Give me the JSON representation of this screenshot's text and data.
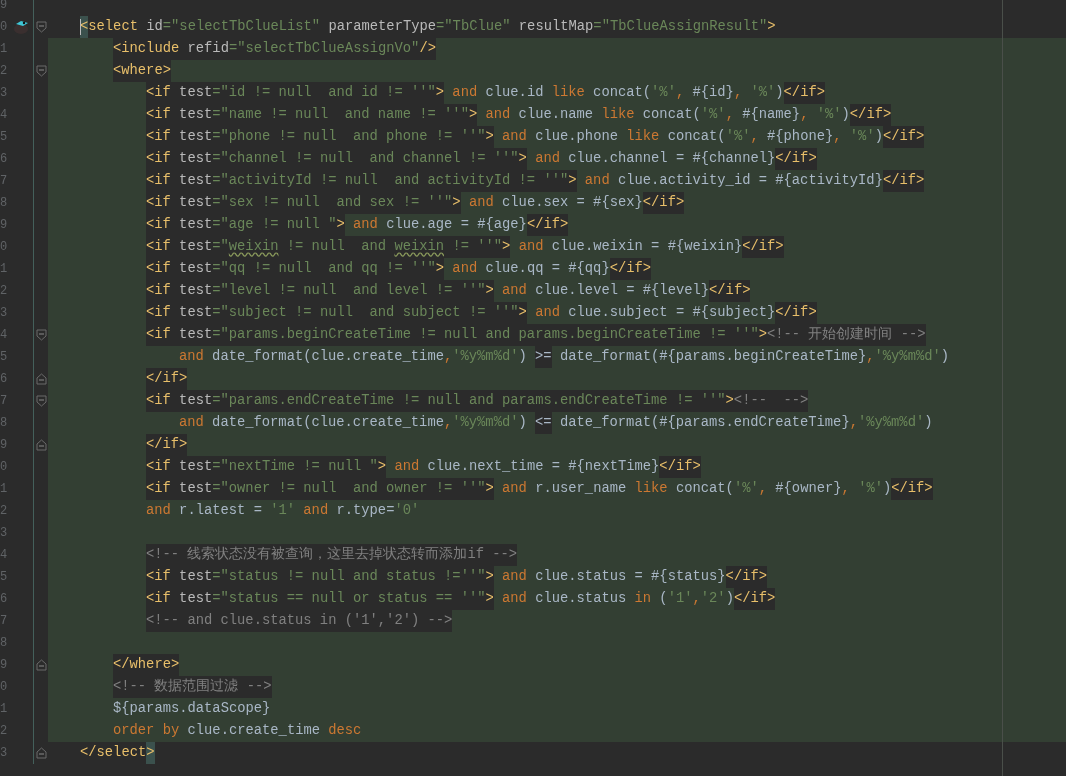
{
  "lines": [
    {
      "number": "9"
    },
    {
      "number": "0",
      "gutter_icon": true,
      "caret": true,
      "fold_start": true,
      "tokens": [
        {
          "kind": "tag",
          "text": "<",
          "matched": true
        },
        {
          "kind": "tag",
          "text": "select"
        },
        {
          "kind": "attr",
          "text": " id"
        },
        {
          "kind": "value",
          "text": "=\"selectTbClueList\""
        },
        {
          "kind": "attr",
          "text": " parameterType"
        },
        {
          "kind": "value",
          "text": "=\"TbClue\""
        },
        {
          "kind": "attr",
          "text": " resultMap"
        },
        {
          "kind": "value",
          "text": "=\"TbClueAssignResult\""
        },
        {
          "kind": "tag",
          "text": ">"
        }
      ],
      "children": [
        {
          "number": "1",
          "tokens": [
            {
              "kind": "tag",
              "text": "<include"
            },
            {
              "kind": "attr",
              "text": " refid"
            },
            {
              "kind": "value",
              "text": "=\"selectTbClueAssignVo\""
            },
            {
              "kind": "tag",
              "text": "/>"
            }
          ]
        },
        {
          "number": "2",
          "fold_start": true,
          "tokens": [
            {
              "kind": "tag",
              "text": "<where>"
            }
          ],
          "children": [
            {
              "number": "3",
              "tokens": [
                {
                  "kind": "tag",
                  "text": "<if"
                },
                {
                  "kind": "attr",
                  "text": " test"
                },
                {
                  "kind": "value",
                  "text": "=\"id != null  and id != ''\""
                },
                {
                  "kind": "tag",
                  "text": ">"
                },
                {
                  "kind": "kw",
                  "text": " and"
                },
                {
                  "kind": "plain",
                  "text": " clue.id "
                },
                {
                  "kind": "kw",
                  "text": "like"
                },
                {
                  "kind": "plain",
                  "text": " concat("
                },
                {
                  "kind": "str",
                  "text": "'%'"
                },
                {
                  "kind": "kw",
                  "text": ", "
                },
                {
                  "kind": "plain",
                  "text": "#{id}"
                },
                {
                  "kind": "kw",
                  "text": ", "
                },
                {
                  "kind": "str",
                  "text": "'%'"
                },
                {
                  "kind": "plain",
                  "text": ")"
                },
                {
                  "kind": "tag",
                  "text": "</if>"
                }
              ]
            },
            {
              "number": "4",
              "tokens": [
                {
                  "kind": "tag",
                  "text": "<if"
                },
                {
                  "kind": "attr",
                  "text": " test"
                },
                {
                  "kind": "value",
                  "text": "=\"name != null  and name != ''\""
                },
                {
                  "kind": "tag",
                  "text": ">"
                },
                {
                  "kind": "kw",
                  "text": " and"
                },
                {
                  "kind": "plain",
                  "text": " clue.name "
                },
                {
                  "kind": "kw",
                  "text": "like"
                },
                {
                  "kind": "plain",
                  "text": " concat("
                },
                {
                  "kind": "str",
                  "text": "'%'"
                },
                {
                  "kind": "kw",
                  "text": ", "
                },
                {
                  "kind": "plain",
                  "text": "#{name}"
                },
                {
                  "kind": "kw",
                  "text": ", "
                },
                {
                  "kind": "str",
                  "text": "'%'"
                },
                {
                  "kind": "plain",
                  "text": ")"
                },
                {
                  "kind": "tag",
                  "text": "</if>"
                }
              ]
            },
            {
              "number": "5",
              "tokens": [
                {
                  "kind": "tag",
                  "text": "<if"
                },
                {
                  "kind": "attr",
                  "text": " test"
                },
                {
                  "kind": "value",
                  "text": "=\"phone != null  and phone != ''\""
                },
                {
                  "kind": "tag",
                  "text": ">"
                },
                {
                  "kind": "kw",
                  "text": " and"
                },
                {
                  "kind": "plain",
                  "text": " clue.phone "
                },
                {
                  "kind": "kw",
                  "text": "like"
                },
                {
                  "kind": "plain",
                  "text": " concat("
                },
                {
                  "kind": "str",
                  "text": "'%'"
                },
                {
                  "kind": "kw",
                  "text": ", "
                },
                {
                  "kind": "plain",
                  "text": "#{phone}"
                },
                {
                  "kind": "kw",
                  "text": ", "
                },
                {
                  "kind": "str",
                  "text": "'%'"
                },
                {
                  "kind": "plain",
                  "text": ")"
                },
                {
                  "kind": "tag",
                  "text": "</if>"
                }
              ]
            },
            {
              "number": "6",
              "tokens": [
                {
                  "kind": "tag",
                  "text": "<if"
                },
                {
                  "kind": "attr",
                  "text": " test"
                },
                {
                  "kind": "value",
                  "text": "=\"channel != null  and channel != ''\""
                },
                {
                  "kind": "tag",
                  "text": ">"
                },
                {
                  "kind": "kw",
                  "text": " and"
                },
                {
                  "kind": "plain",
                  "text": " clue.channel = #{channel}"
                },
                {
                  "kind": "tag",
                  "text": "</if>"
                }
              ]
            },
            {
              "number": "7",
              "tokens": [
                {
                  "kind": "tag",
                  "text": "<if"
                },
                {
                  "kind": "attr",
                  "text": " test"
                },
                {
                  "kind": "value",
                  "text": "=\"activityId != null  and activityId != ''\""
                },
                {
                  "kind": "tag",
                  "text": ">"
                },
                {
                  "kind": "kw",
                  "text": " and"
                },
                {
                  "kind": "plain",
                  "text": " clue.activity_id = #{activityId}"
                },
                {
                  "kind": "tag",
                  "text": "</if>"
                }
              ]
            },
            {
              "number": "8",
              "tokens": [
                {
                  "kind": "tag",
                  "text": "<if"
                },
                {
                  "kind": "attr",
                  "text": " test"
                },
                {
                  "kind": "value",
                  "text": "=\"sex != null  and sex != ''\""
                },
                {
                  "kind": "tag",
                  "text": ">"
                },
                {
                  "kind": "kw",
                  "text": " and"
                },
                {
                  "kind": "plain",
                  "text": " clue.sex = #{sex}"
                },
                {
                  "kind": "tag",
                  "text": "</if>"
                }
              ]
            },
            {
              "number": "9",
              "tokens": [
                {
                  "kind": "tag",
                  "text": "<if"
                },
                {
                  "kind": "attr",
                  "text": " test"
                },
                {
                  "kind": "value",
                  "text": "=\"age != null \""
                },
                {
                  "kind": "tag",
                  "text": ">"
                },
                {
                  "kind": "kw",
                  "text": " and"
                },
                {
                  "kind": "plain",
                  "text": " clue.age = #{age}"
                },
                {
                  "kind": "tag",
                  "text": "</if>"
                }
              ]
            },
            {
              "number": "0",
              "tokens": [
                {
                  "kind": "tag",
                  "text": "<if"
                },
                {
                  "kind": "attr",
                  "text": " test"
                },
                {
                  "kind": "value",
                  "text": "=\""
                },
                {
                  "kind": "value",
                  "text": "weixin",
                  "misspelled": true
                },
                {
                  "kind": "value",
                  "text": " != null  and "
                },
                {
                  "kind": "value",
                  "text": "weixin",
                  "misspelled": true
                },
                {
                  "kind": "value",
                  "text": " != ''\""
                },
                {
                  "kind": "tag",
                  "text": ">"
                },
                {
                  "kind": "kw",
                  "text": " and"
                },
                {
                  "kind": "plain",
                  "text": " clue.weixin = #{weixin}"
                },
                {
                  "kind": "tag",
                  "text": "</if>"
                }
              ]
            },
            {
              "number": "1",
              "tokens": [
                {
                  "kind": "tag",
                  "text": "<if"
                },
                {
                  "kind": "attr",
                  "text": " test"
                },
                {
                  "kind": "value",
                  "text": "=\"qq != null  and qq != ''\""
                },
                {
                  "kind": "tag",
                  "text": ">"
                },
                {
                  "kind": "kw",
                  "text": " and"
                },
                {
                  "kind": "plain",
                  "text": " clue.qq = #{qq}"
                },
                {
                  "kind": "tag",
                  "text": "</if>"
                }
              ]
            },
            {
              "number": "2",
              "tokens": [
                {
                  "kind": "tag",
                  "text": "<if"
                },
                {
                  "kind": "attr",
                  "text": " test"
                },
                {
                  "kind": "value",
                  "text": "=\"level != null  and level != ''\""
                },
                {
                  "kind": "tag",
                  "text": ">"
                },
                {
                  "kind": "kw",
                  "text": " and"
                },
                {
                  "kind": "plain",
                  "text": " clue.level = #{level}"
                },
                {
                  "kind": "tag",
                  "text": "</if>"
                }
              ]
            },
            {
              "number": "3",
              "tokens": [
                {
                  "kind": "tag",
                  "text": "<if"
                },
                {
                  "kind": "attr",
                  "text": " test"
                },
                {
                  "kind": "value",
                  "text": "=\"subject != null  and subject != ''\""
                },
                {
                  "kind": "tag",
                  "text": ">"
                },
                {
                  "kind": "kw",
                  "text": " and"
                },
                {
                  "kind": "plain",
                  "text": " clue.subject = #{subject}"
                },
                {
                  "kind": "tag",
                  "text": "</if>"
                }
              ]
            },
            {
              "number": "4",
              "fold_start": true,
              "tokens": [
                {
                  "kind": "tag",
                  "text": "<if"
                },
                {
                  "kind": "attr",
                  "text": " test"
                },
                {
                  "kind": "value",
                  "text": "=\"params.beginCreateTime != null and params.beginCreateTime != ''\""
                },
                {
                  "kind": "tag",
                  "text": ">"
                },
                {
                  "kind": "comment",
                  "text": "<!-- 开始创建时间 -->"
                }
              ],
              "children": [
                {
                  "number": "5",
                  "tokens": [
                    {
                      "kind": "kw",
                      "text": "and"
                    },
                    {
                      "kind": "plain",
                      "text": " date_format(clue.create_time"
                    },
                    {
                      "kind": "kw",
                      "text": ","
                    },
                    {
                      "kind": "str",
                      "text": "'%y%m%d'"
                    },
                    {
                      "kind": "plain",
                      "text": ") "
                    },
                    {
                      "kind": "entity",
                      "text": ">="
                    },
                    {
                      "kind": "plain",
                      "text": " date_format(#{params.beginCreateTime}"
                    },
                    {
                      "kind": "kw",
                      "text": ","
                    },
                    {
                      "kind": "str",
                      "text": "'%y%m%d'"
                    },
                    {
                      "kind": "plain",
                      "text": ")"
                    }
                  ]
                }
              ]
            },
            {
              "number": "6",
              "fold_end": true,
              "tokens": [
                {
                  "kind": "tag",
                  "text": "</if>"
                }
              ]
            },
            {
              "number": "7",
              "fold_start": true,
              "tokens": [
                {
                  "kind": "tag",
                  "text": "<if"
                },
                {
                  "kind": "attr",
                  "text": " test"
                },
                {
                  "kind": "value",
                  "text": "=\"params.endCreateTime != null and params.endCreateTime != ''\""
                },
                {
                  "kind": "tag",
                  "text": ">"
                },
                {
                  "kind": "comment",
                  "text": "<!--  -->"
                }
              ],
              "children": [
                {
                  "number": "8",
                  "tokens": [
                    {
                      "kind": "kw",
                      "text": "and"
                    },
                    {
                      "kind": "plain",
                      "text": " date_format(clue.create_time"
                    },
                    {
                      "kind": "kw",
                      "text": ","
                    },
                    {
                      "kind": "str",
                      "text": "'%y%m%d'"
                    },
                    {
                      "kind": "plain",
                      "text": ") "
                    },
                    {
                      "kind": "entity",
                      "text": "<="
                    },
                    {
                      "kind": "plain",
                      "text": " date_format(#{params.endCreateTime}"
                    },
                    {
                      "kind": "kw",
                      "text": ","
                    },
                    {
                      "kind": "str",
                      "text": "'%y%m%d'"
                    },
                    {
                      "kind": "plain",
                      "text": ")"
                    }
                  ]
                }
              ]
            },
            {
              "number": "9",
              "fold_end": true,
              "tokens": [
                {
                  "kind": "tag",
                  "text": "</if>"
                }
              ]
            },
            {
              "number": "0",
              "tokens": [
                {
                  "kind": "tag",
                  "text": "<if"
                },
                {
                  "kind": "attr",
                  "text": " test"
                },
                {
                  "kind": "value",
                  "text": "=\"nextTime != null \""
                },
                {
                  "kind": "tag",
                  "text": ">"
                },
                {
                  "kind": "kw",
                  "text": " and"
                },
                {
                  "kind": "plain",
                  "text": " clue.next_time = #{nextTime}"
                },
                {
                  "kind": "tag",
                  "text": "</if>"
                }
              ]
            },
            {
              "number": "1",
              "tokens": [
                {
                  "kind": "tag",
                  "text": "<if"
                },
                {
                  "kind": "attr",
                  "text": " test"
                },
                {
                  "kind": "value",
                  "text": "=\"owner != null  and owner != ''\""
                },
                {
                  "kind": "tag",
                  "text": ">"
                },
                {
                  "kind": "kw",
                  "text": " and"
                },
                {
                  "kind": "plain",
                  "text": " r.user_name "
                },
                {
                  "kind": "kw",
                  "text": "like"
                },
                {
                  "kind": "plain",
                  "text": " concat("
                },
                {
                  "kind": "str",
                  "text": "'%'"
                },
                {
                  "kind": "kw",
                  "text": ", "
                },
                {
                  "kind": "plain",
                  "text": "#{owner}"
                },
                {
                  "kind": "kw",
                  "text": ", "
                },
                {
                  "kind": "str",
                  "text": "'%'"
                },
                {
                  "kind": "plain",
                  "text": ")"
                },
                {
                  "kind": "tag",
                  "text": "</if>"
                }
              ]
            },
            {
              "number": "2",
              "tokens": [
                {
                  "kind": "kw",
                  "text": "and"
                },
                {
                  "kind": "plain",
                  "text": " r.latest = "
                },
                {
                  "kind": "str",
                  "text": "'1'"
                },
                {
                  "kind": "kw",
                  "text": " and"
                },
                {
                  "kind": "plain",
                  "text": " r.type="
                },
                {
                  "kind": "str",
                  "text": "'0'"
                }
              ]
            },
            {
              "number": "3"
            },
            {
              "number": "4",
              "tokens": [
                {
                  "kind": "comment",
                  "text": "<!-- 线索状态没有被查询，这里去掉状态转而添加if -->"
                }
              ]
            },
            {
              "number": "5",
              "tokens": [
                {
                  "kind": "tag",
                  "text": "<if"
                },
                {
                  "kind": "attr",
                  "text": " test"
                },
                {
                  "kind": "value",
                  "text": "=\"status != null and status !=''\""
                },
                {
                  "kind": "tag",
                  "text": ">"
                },
                {
                  "kind": "kw",
                  "text": " and"
                },
                {
                  "kind": "plain",
                  "text": " clue.status = #{status}"
                },
                {
                  "kind": "tag",
                  "text": "</if>"
                }
              ]
            },
            {
              "number": "6",
              "tokens": [
                {
                  "kind": "tag",
                  "text": "<if"
                },
                {
                  "kind": "attr",
                  "text": " test"
                },
                {
                  "kind": "value",
                  "text": "=\"status == null or status == ''\""
                },
                {
                  "kind": "tag",
                  "text": ">"
                },
                {
                  "kind": "kw",
                  "text": " and"
                },
                {
                  "kind": "plain",
                  "text": " clue.status "
                },
                {
                  "kind": "kw",
                  "text": "in"
                },
                {
                  "kind": "plain",
                  "text": " ("
                },
                {
                  "kind": "str",
                  "text": "'1'"
                },
                {
                  "kind": "kw",
                  "text": ","
                },
                {
                  "kind": "str",
                  "text": "'2'"
                },
                {
                  "kind": "plain",
                  "text": ")"
                },
                {
                  "kind": "tag",
                  "text": "</if>"
                }
              ]
            },
            {
              "number": "7",
              "tokens": [
                {
                  "kind": "comment",
                  "text": "<!-- and clue.status in ('1','2') -->"
                }
              ]
            },
            {
              "number": "8"
            }
          ]
        },
        {
          "number": "9",
          "fold_end": true,
          "tokens": [
            {
              "kind": "tag",
              "text": "</where>"
            }
          ]
        },
        {
          "number": "0",
          "tokens": [
            {
              "kind": "comment",
              "text": "<!-- 数据范围过滤 -->"
            }
          ]
        },
        {
          "number": "1",
          "tokens": [
            {
              "kind": "plain",
              "text": "${params.dataScope}"
            }
          ]
        },
        {
          "number": "2",
          "tokens": [
            {
              "kind": "kw",
              "text": "order by"
            },
            {
              "kind": "plain",
              "text": " clue.create_time "
            },
            {
              "kind": "kw",
              "text": "desc"
            }
          ]
        }
      ]
    },
    {
      "number": "3",
      "fold_end": true,
      "tokens": [
        {
          "kind": "tag",
          "text": "</select"
        },
        {
          "kind": "tag",
          "text": ">",
          "matched": true
        }
      ]
    }
  ]
}
